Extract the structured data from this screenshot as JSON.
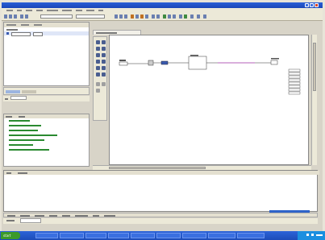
{
  "taskbar": {
    "start_label": "start",
    "items": [
      "",
      "",
      "",
      "",
      "",
      "",
      "",
      "",
      ""
    ]
  }
}
